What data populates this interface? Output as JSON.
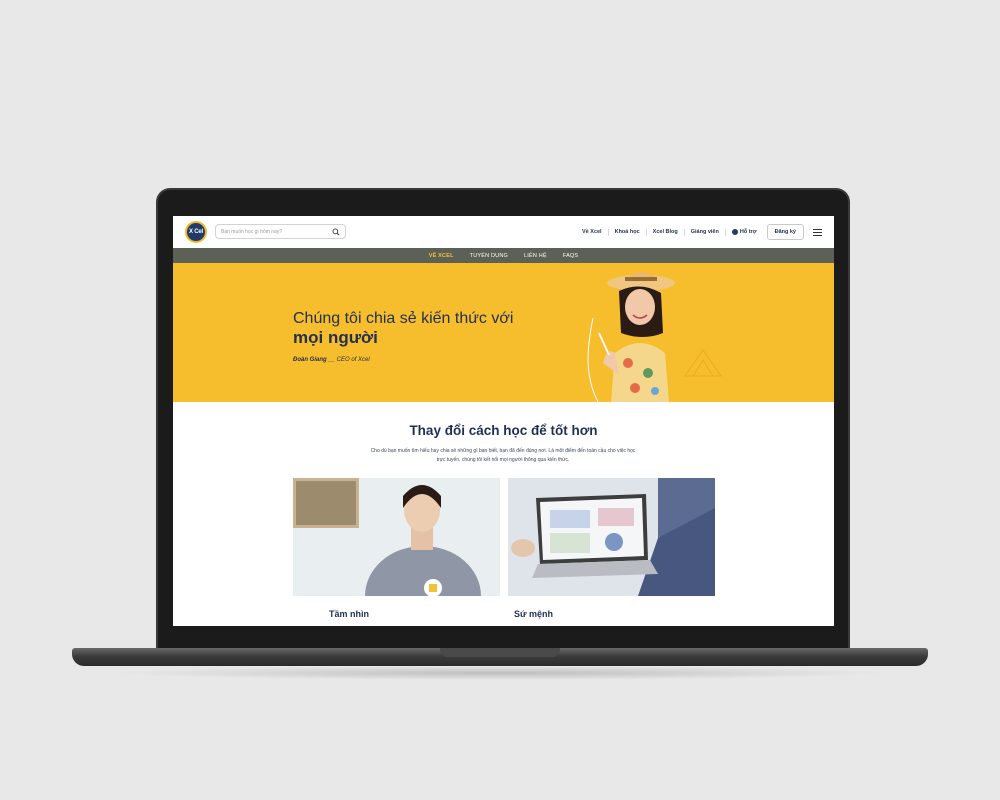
{
  "header": {
    "logo_text": "X Cel",
    "search_placeholder": "Bạn muốn học gì hôm nay?",
    "nav": [
      "Về Xcel",
      "Khoá học",
      "Xcel Blog",
      "Giảng viên"
    ],
    "support_label": "Hỗ trợ",
    "signup_label": "Đăng ký"
  },
  "subnav": {
    "items": [
      "VỀ XCEL",
      "TUYỂN DỤNG",
      "LIÊN HỆ",
      "FAQS"
    ],
    "active_index": 0
  },
  "hero": {
    "title_line1": "Chúng tôi chia sẻ kiến thức với",
    "title_line2": "mọi người",
    "caption_name": "Đoàn Giang",
    "caption_role": "__ CEO of Xcel"
  },
  "content": {
    "title": "Thay đổi cách học để tốt hơn",
    "description": "Cho dù bạn muốn tìm hiểu hay chia sẻ những gì bạn biết, bạn đã đến đúng nơi. Là một điểm đến toàn cầu cho việc học trực tuyến, chúng tôi kết nối mọi người thông qua kiến thức.",
    "cards": [
      {
        "title": "Tầm nhìn"
      },
      {
        "title": "Sứ mệnh"
      }
    ]
  },
  "colors": {
    "brand_navy": "#1f3a6b",
    "hero_yellow": "#f6bd2c",
    "subnav_bg": "#5c6157",
    "active_nav": "#f6c136"
  }
}
